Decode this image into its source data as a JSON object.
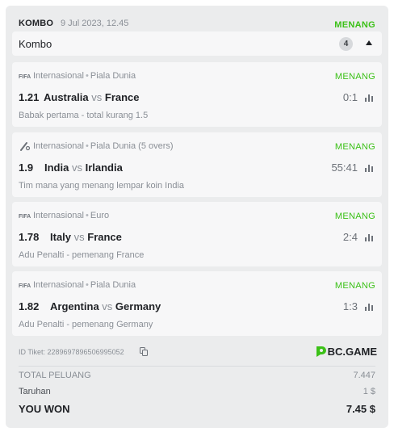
{
  "header": {
    "type": "KOMBO",
    "date": "9 Jul 2023, 12.45",
    "status": "MENANG"
  },
  "combo": {
    "label": "Kombo",
    "count": "4"
  },
  "bets": [
    {
      "sport_icon": "fifa-icon",
      "category": "Internasional",
      "league": "Piala Dunia",
      "result": "MENANG",
      "odds": "1.21",
      "home": "Australia",
      "vs": "vs",
      "away": "France",
      "score": "0:1",
      "market": "Babak pertama - total kurang 1.5"
    },
    {
      "sport_icon": "cricket-icon",
      "category": "Internasional",
      "league": "Piala Dunia (5 overs)",
      "result": "MENANG",
      "odds": "1.9",
      "home": "India",
      "vs": "vs",
      "away": "Irlandia",
      "score": "55:41",
      "market": "Tim mana yang menang lempar koin India"
    },
    {
      "sport_icon": "fifa-icon",
      "category": "Internasional",
      "league": "Euro",
      "result": "MENANG",
      "odds": "1.78",
      "home": "Italy",
      "vs": "vs",
      "away": "France",
      "score": "2:4",
      "market": "Adu Penalti - pemenang France"
    },
    {
      "sport_icon": "fifa-icon",
      "category": "Internasional",
      "league": "Piala Dunia",
      "result": "MENANG",
      "odds": "1.82",
      "home": "Argentina",
      "vs": "vs",
      "away": "Germany",
      "score": "1:3",
      "market": "Adu Penalti - pemenang Germany"
    }
  ],
  "ticket": {
    "id_label": "ID Tiket: 2289697896506995052",
    "brand": "BC.GAME"
  },
  "summary": {
    "total_odds_label": "TOTAL PELUANG",
    "total_odds_value": "7.447",
    "stake_label": "Taruhan",
    "stake_value": "1 $",
    "won_label": "YOU WON",
    "won_value": "7.45 $"
  },
  "colors": {
    "win_green": "#3bc117",
    "card_bg": "#f7f7f8",
    "ticket_bg": "#ebeced"
  }
}
